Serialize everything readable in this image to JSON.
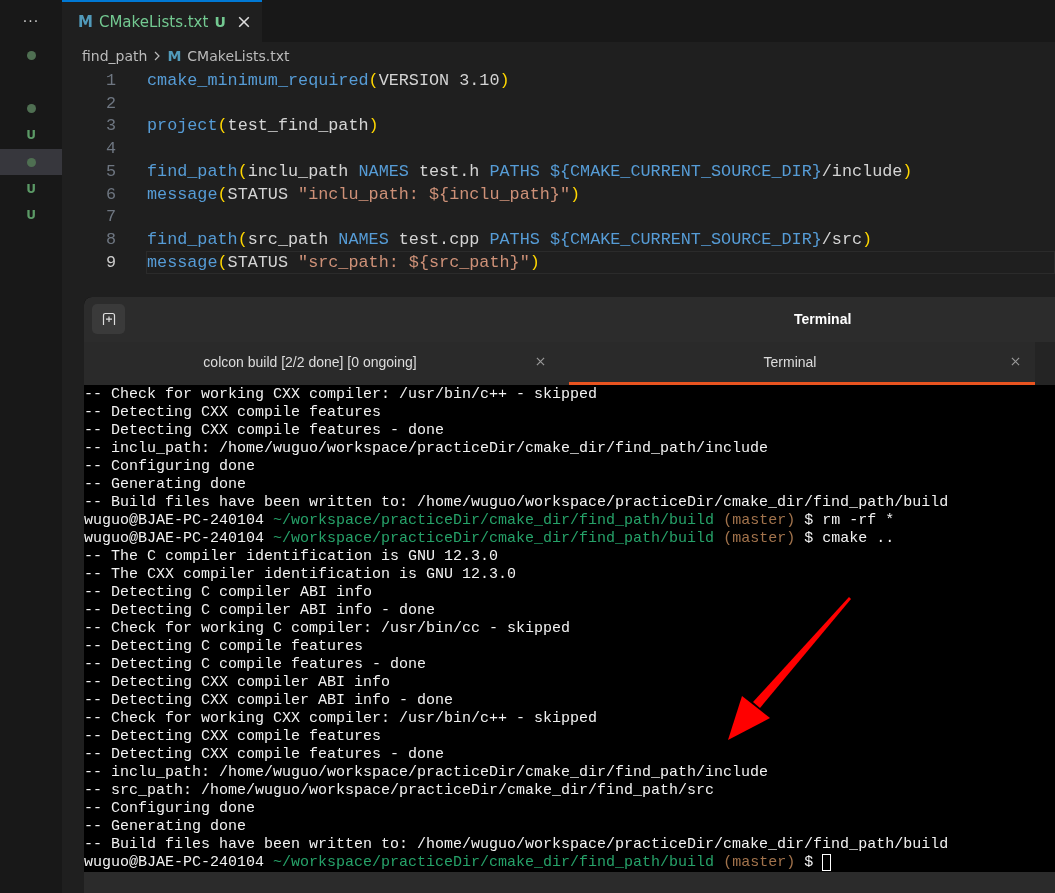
{
  "activity_bar": {
    "more": "···",
    "items": [
      {
        "kind": "dot",
        "selected": false
      },
      {
        "kind": "dot",
        "selected": false
      },
      {
        "kind": "letter",
        "text": "U",
        "selected": false
      },
      {
        "kind": "dot",
        "selected": true
      },
      {
        "kind": "letter",
        "text": "U",
        "selected": false
      },
      {
        "kind": "letter",
        "text": "U",
        "selected": false
      }
    ]
  },
  "editor_tabs": [
    {
      "icon": "M",
      "title": "CMakeLists.txt",
      "status": "U",
      "selected": true
    }
  ],
  "breadcrumbs": [
    {
      "label": "find_path"
    },
    {
      "icon": "M",
      "label": "CMakeLists.txt"
    }
  ],
  "code_lines": [
    {
      "number": "1",
      "current": false,
      "tokens": [
        {
          "kind": "fn",
          "text": "cmake_minimum_required"
        },
        {
          "kind": "paren",
          "text": "("
        },
        {
          "kind": "text",
          "text": "VERSION 3.10"
        },
        {
          "kind": "paren",
          "text": ")"
        }
      ]
    },
    {
      "number": "2",
      "current": false
    },
    {
      "number": "3",
      "current": false,
      "tokens": [
        {
          "kind": "fn",
          "text": "project"
        },
        {
          "kind": "paren",
          "text": "("
        },
        {
          "kind": "text",
          "text": "test_find_path"
        },
        {
          "kind": "paren",
          "text": ")"
        }
      ]
    },
    {
      "number": "4",
      "current": false
    },
    {
      "number": "5",
      "current": false,
      "tokens": [
        {
          "kind": "fn",
          "text": "find_path"
        },
        {
          "kind": "paren",
          "text": "("
        },
        {
          "kind": "text",
          "text": "inclu_path "
        },
        {
          "kind": "kw",
          "text": "NAMES"
        },
        {
          "kind": "text",
          "text": " test.h "
        },
        {
          "kind": "kw",
          "text": "PATHS "
        },
        {
          "kind": "var",
          "text": "${CMAKE_CURRENT_SOURCE_DIR}"
        },
        {
          "kind": "text",
          "text": "/include"
        },
        {
          "kind": "paren",
          "text": ")"
        }
      ]
    },
    {
      "number": "6",
      "current": false,
      "tokens": [
        {
          "kind": "fn",
          "text": "message"
        },
        {
          "kind": "paren",
          "text": "("
        },
        {
          "kind": "text",
          "text": "STATUS "
        },
        {
          "kind": "str",
          "text": "\"inclu_path: ${inclu_path}\""
        },
        {
          "kind": "paren",
          "text": ")"
        }
      ]
    },
    {
      "number": "7",
      "current": false
    },
    {
      "number": "8",
      "current": false,
      "tokens": [
        {
          "kind": "fn",
          "text": "find_path"
        },
        {
          "kind": "paren",
          "text": "("
        },
        {
          "kind": "text",
          "text": "src_path "
        },
        {
          "kind": "kw",
          "text": "NAMES"
        },
        {
          "kind": "text",
          "text": " test.cpp "
        },
        {
          "kind": "kw",
          "text": "PATHS "
        },
        {
          "kind": "var",
          "text": "${CMAKE_CURRENT_SOURCE_DIR}"
        },
        {
          "kind": "text",
          "text": "/src"
        },
        {
          "kind": "paren",
          "text": ")"
        }
      ]
    },
    {
      "number": "9",
      "current": true,
      "tokens": [
        {
          "kind": "fn",
          "text": "message"
        },
        {
          "kind": "paren",
          "text": "("
        },
        {
          "kind": "text",
          "text": "STATUS "
        },
        {
          "kind": "str",
          "text": "\"src_path: ${src_path}\""
        },
        {
          "kind": "paren",
          "text": ")"
        }
      ]
    }
  ],
  "terminal": {
    "title": "Terminal",
    "tabs": [
      {
        "label": "colcon build [2/2 done] [0 ongoing]",
        "selected": false
      },
      {
        "label": "Terminal",
        "selected": true
      }
    ],
    "lines": [
      {
        "kind": "output",
        "text": "-- Check for working CXX compiler: /usr/bin/c++ - skipped"
      },
      {
        "kind": "output",
        "text": "-- Detecting CXX compile features"
      },
      {
        "kind": "output",
        "text": "-- Detecting CXX compile features - done"
      },
      {
        "kind": "output",
        "text": "-- inclu_path: /home/wuguo/workspace/practiceDir/cmake_dir/find_path/include"
      },
      {
        "kind": "output",
        "text": "-- Configuring done"
      },
      {
        "kind": "output",
        "text": "-- Generating done"
      },
      {
        "kind": "output",
        "text": "-- Build files have been written to: /home/wuguo/workspace/practiceDir/cmake_dir/find_path/build"
      },
      {
        "kind": "prompt",
        "user": "wuguo@BJAE-PC-240104",
        "path": "~/workspace/practiceDir/cmake_dir/find_path/build",
        "branch": "(master)",
        "command": "$ rm -rf *",
        "cursor": false
      },
      {
        "kind": "prompt",
        "user": "wuguo@BJAE-PC-240104",
        "path": "~/workspace/practiceDir/cmake_dir/find_path/build",
        "branch": "(master)",
        "command": "$ cmake ..",
        "cursor": false
      },
      {
        "kind": "output",
        "text": "-- The C compiler identification is GNU 12.3.0"
      },
      {
        "kind": "output",
        "text": "-- The CXX compiler identification is GNU 12.3.0"
      },
      {
        "kind": "output",
        "text": "-- Detecting C compiler ABI info"
      },
      {
        "kind": "output",
        "text": "-- Detecting C compiler ABI info - done"
      },
      {
        "kind": "output",
        "text": "-- Check for working C compiler: /usr/bin/cc - skipped"
      },
      {
        "kind": "output",
        "text": "-- Detecting C compile features"
      },
      {
        "kind": "output",
        "text": "-- Detecting C compile features - done"
      },
      {
        "kind": "output",
        "text": "-- Detecting CXX compiler ABI info"
      },
      {
        "kind": "output",
        "text": "-- Detecting CXX compiler ABI info - done"
      },
      {
        "kind": "output",
        "text": "-- Check for working CXX compiler: /usr/bin/c++ - skipped"
      },
      {
        "kind": "output",
        "text": "-- Detecting CXX compile features"
      },
      {
        "kind": "output",
        "text": "-- Detecting CXX compile features - done"
      },
      {
        "kind": "output",
        "text": "-- inclu_path: /home/wuguo/workspace/practiceDir/cmake_dir/find_path/include"
      },
      {
        "kind": "output",
        "text": "-- src_path: /home/wuguo/workspace/practiceDir/cmake_dir/find_path/src"
      },
      {
        "kind": "output",
        "text": "-- Configuring done"
      },
      {
        "kind": "output",
        "text": "-- Generating done"
      },
      {
        "kind": "output",
        "text": "-- Build files have been written to: /home/wuguo/workspace/practiceDir/cmake_dir/find_path/build"
      },
      {
        "kind": "prompt",
        "user": "wuguo@BJAE-PC-240104",
        "path": "~/workspace/practiceDir/cmake_dir/find_path/build",
        "branch": "(master)",
        "command": "$",
        "cursor": true
      }
    ]
  }
}
